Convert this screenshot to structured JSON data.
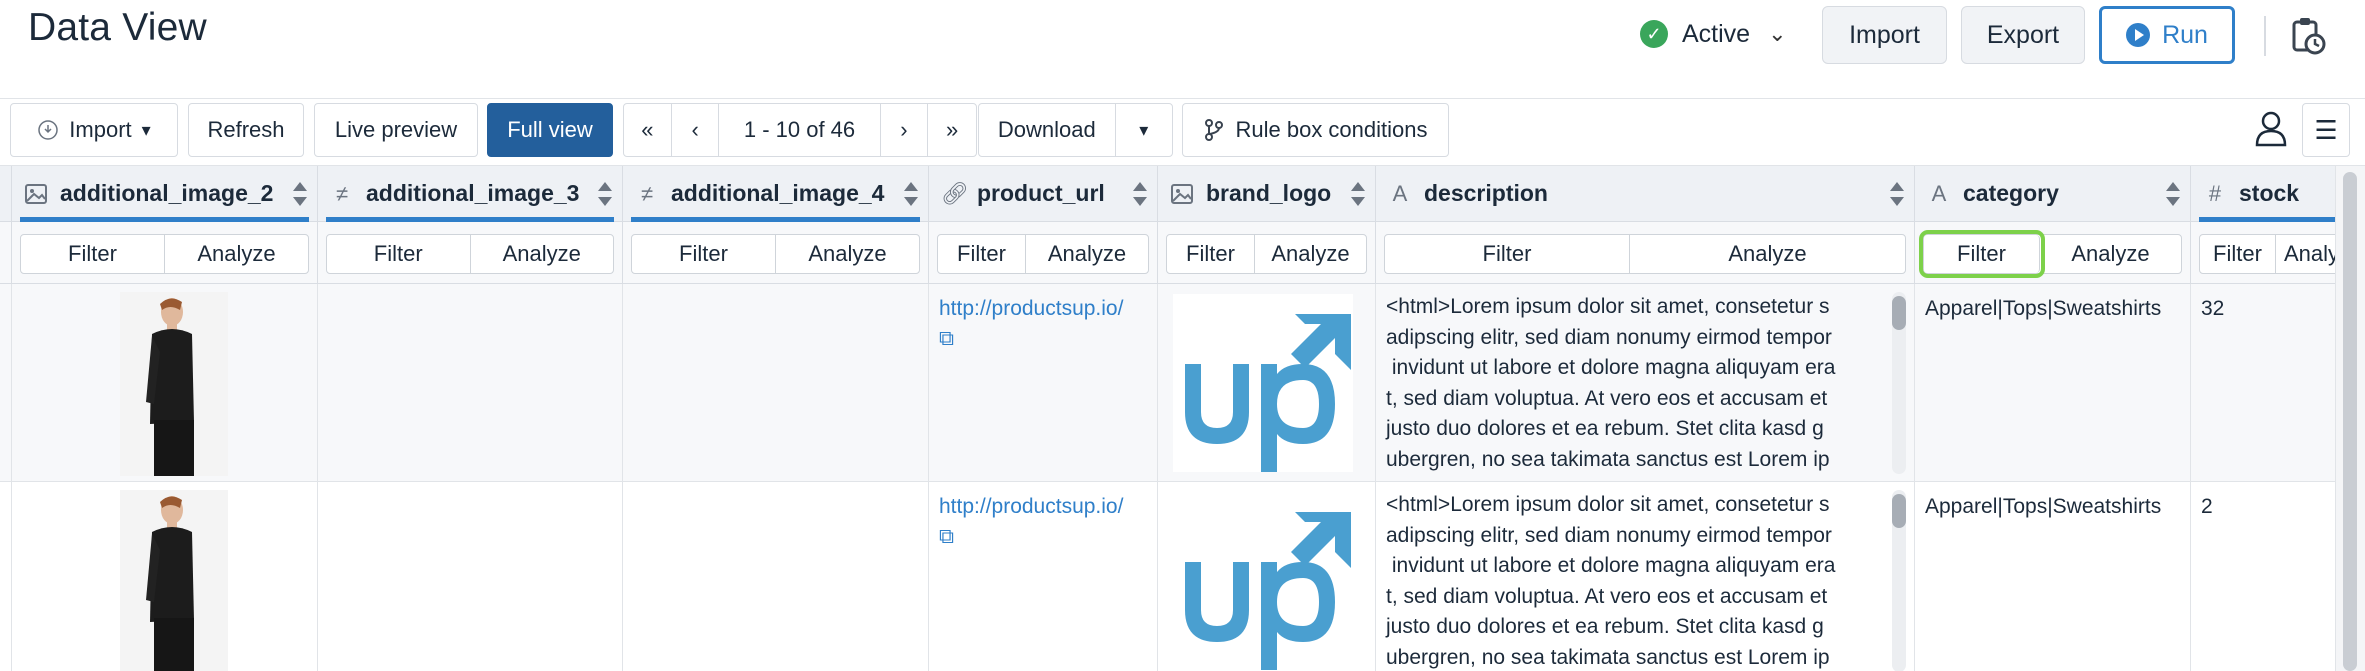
{
  "header": {
    "title": "Data View",
    "status_label": "Active",
    "status_color": "#3aa65b",
    "import_label": "Import",
    "export_label": "Export",
    "run_label": "Run"
  },
  "toolbar": {
    "import_label": "Import",
    "refresh_label": "Refresh",
    "live_preview_label": "Live preview",
    "full_view_label": "Full view",
    "first_page": "«",
    "prev_page": "‹",
    "pagination": "1 - 10 of 46",
    "next_page": "›",
    "last_page": "»",
    "download_label": "Download",
    "rule_box_label": "Rule box conditions"
  },
  "filter_label": "Filter",
  "analyze_label": "Analyze",
  "columns": [
    {
      "name": "additional_image_2",
      "type_icon": "image-icon"
    },
    {
      "name": "additional_image_3",
      "type_icon": "not-equal-icon"
    },
    {
      "name": "additional_image_4",
      "type_icon": "not-equal-icon"
    },
    {
      "name": "product_url",
      "type_icon": "link-icon"
    },
    {
      "name": "brand_logo",
      "type_icon": "image-icon"
    },
    {
      "name": "description",
      "type_icon": "text-icon"
    },
    {
      "name": "category",
      "type_icon": "text-icon"
    },
    {
      "name": "stock",
      "type_icon": "hash-icon"
    }
  ],
  "rows": [
    {
      "product_url": "http://productsup.io/",
      "description": "<html>Lorem ipsum dolor sit amet, consetetur s\nadipscing elitr, sed diam nonumy eirmod tempor\n invidunt ut labore et dolore magna aliquyam era\nt, sed diam voluptua. At vero eos et accusam et\njusto duo dolores et ea rebum. Stet clita kasd g\nubergren, no sea takimata sanctus est Lorem ip",
      "category": "Apparel|Tops|Sweatshirts",
      "stock": "32"
    },
    {
      "product_url": "http://productsup.io/",
      "description": "<html>Lorem ipsum dolor sit amet, consetetur s\nadipscing elitr, sed diam nonumy eirmod tempor\n invidunt ut labore et dolore magna aliquyam era\nt, sed diam voluptua. At vero eos et accusam et\njusto duo dolores et ea rebum. Stet clita kasd g\nubergren, no sea takimata sanctus est Lorem ip",
      "category": "Apparel|Tops|Sweatshirts",
      "stock": "2"
    }
  ],
  "colors": {
    "accent": "#2f7fc9",
    "primary_button": "#235f9c",
    "highlight": "#7dd14a",
    "logo_blue": "#4a9fd0"
  }
}
